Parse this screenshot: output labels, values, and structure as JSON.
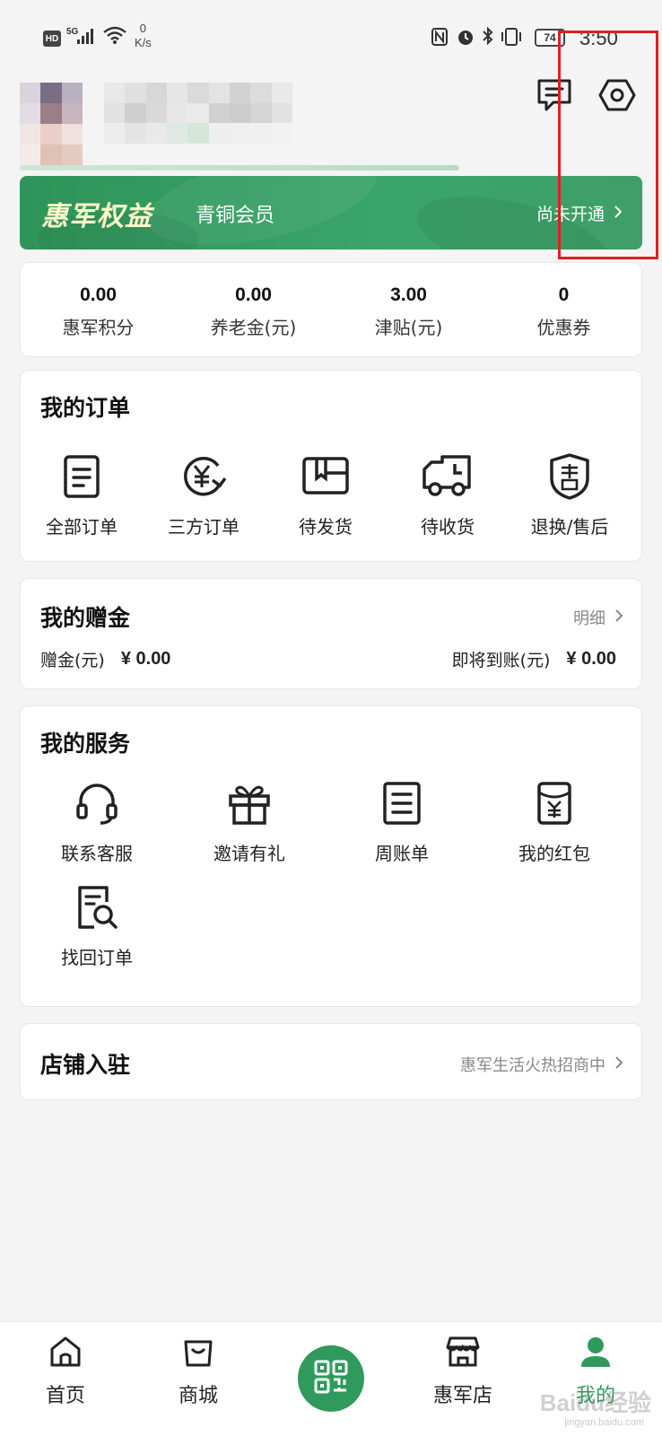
{
  "status_bar": {
    "hd": "HD",
    "network": "5G",
    "speed_value": "0",
    "speed_unit": "K/s",
    "battery": "74",
    "time": "3:50"
  },
  "header": {
    "message_icon": "message-icon",
    "settings_icon": "settings-hexagon-icon"
  },
  "banner": {
    "title": "惠军权益",
    "level": "青铜会员",
    "action": "尚未开通"
  },
  "stats": [
    {
      "value": "0.00",
      "label": "惠军积分"
    },
    {
      "value": "0.00",
      "label": "养老金(元)"
    },
    {
      "value": "3.00",
      "label": "津贴(元)"
    },
    {
      "value": "0",
      "label": "优惠券"
    }
  ],
  "orders": {
    "title": "我的订单",
    "items": [
      {
        "label": "全部订单",
        "icon": "order-list-icon"
      },
      {
        "label": "三方订单",
        "icon": "yuan-cycle-icon"
      },
      {
        "label": "待发货",
        "icon": "package-icon"
      },
      {
        "label": "待收货",
        "icon": "truck-icon"
      },
      {
        "label": "退换/售后",
        "icon": "after-sale-shield-icon"
      }
    ]
  },
  "gift": {
    "title": "我的赠金",
    "detail": "明细",
    "balance_label": "赠金(元)",
    "balance_value": "¥ 0.00",
    "pending_label": "即将到账(元)",
    "pending_value": "¥ 0.00"
  },
  "services": {
    "title": "我的服务",
    "items": [
      {
        "label": "联系客服",
        "icon": "headset-icon"
      },
      {
        "label": "邀请有礼",
        "icon": "gift-box-icon"
      },
      {
        "label": "周账单",
        "icon": "bill-icon"
      },
      {
        "label": "我的红包",
        "icon": "red-envelope-icon"
      },
      {
        "label": "找回订单",
        "icon": "search-document-icon"
      }
    ]
  },
  "shop": {
    "title": "店铺入驻",
    "subtitle": "惠军生活火热招商中"
  },
  "bottom_nav": {
    "items": [
      {
        "label": "首页",
        "icon": "home-icon"
      },
      {
        "label": "商城",
        "icon": "shopping-bag-icon"
      },
      {
        "label": "惠军店",
        "icon": "store-icon"
      },
      {
        "label": "我的",
        "icon": "profile-icon"
      }
    ],
    "center_icon": "qr-code-icon"
  },
  "watermark": {
    "text": "Baidu经验",
    "sub": "jingyan.baidu.com"
  },
  "colors": {
    "brand_green": "#2f9a5c",
    "highlight_box": "#e02020"
  }
}
